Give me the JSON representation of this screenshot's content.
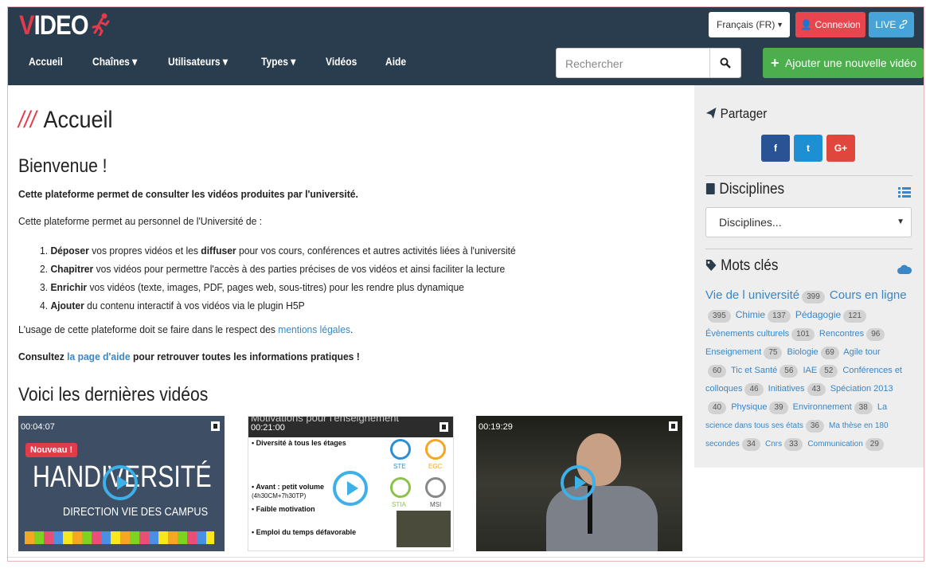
{
  "header": {
    "logo": {
      "prefix": "V",
      "rest": "IDEO"
    },
    "language": "Français (FR)",
    "login": "Connexion",
    "live": "LIVE",
    "nav": [
      {
        "label": "Accueil"
      },
      {
        "label": "Chaînes ▾"
      },
      {
        "label": "Utilisateurs ▾"
      },
      {
        "label": "Types ▾"
      },
      {
        "label": "Vidéos"
      },
      {
        "label": "Aide"
      }
    ],
    "search_placeholder": "Rechercher",
    "add_video": "Ajouter une nouvelle vidéo"
  },
  "main": {
    "title_prefix": "///",
    "title": "Accueil",
    "welcome": "Bienvenue !",
    "intro_bold": "Cette plateforme permet de consulter les vidéos produites par l'université.",
    "intro2": "Cette plateforme permet au personnel de l'Université de :",
    "list": [
      {
        "n": "1.",
        "b": "Déposer",
        "t": " vos propres vidéos et les ",
        "b2": "diffuser",
        "t2": " pour vos cours, conférences et autres activités liées à l'université"
      },
      {
        "n": "2.",
        "b": "Chapitrer",
        "t": " vos vidéos pour permettre l'accès à des parties précises de vos vidéos et ainsi faciliter la lecture",
        "b2": "",
        "t2": ""
      },
      {
        "n": "3.",
        "b": "Enrichir",
        "t": " vos vidéos (texte, images, PDF, pages web, sous-titres) pour les rendre plus dynamique",
        "b2": "",
        "t2": ""
      },
      {
        "n": "4.",
        "b": "Ajouter",
        "t": " du contenu interactif à vos vidéos via le plugin H5P",
        "b2": "",
        "t2": ""
      }
    ],
    "usage_text": "L'usage de cette plateforme doit se faire dans le respect des ",
    "usage_link": "mentions légales",
    "usage_end": ".",
    "help_text": "Consultez ",
    "help_link": "la page d'aide",
    "help_end": " pour retrouver toutes les informations pratiques !",
    "latest_title": "Voici les dernières vidéos",
    "videos": [
      {
        "duration": "00:04:07",
        "badge": "Nouveau !",
        "big": "HANDIVERSITÉ",
        "sub": "DIRECTION VIE DES CAMPUS"
      },
      {
        "duration": "00:21:00",
        "top": "Motivations pour l'enseignement",
        "b1": "• Diversité à tous les étages",
        "b2": "• Avant : petit volume",
        "b2s": "(4h30CM+7h30TP)",
        "b3": "• Faible motivation",
        "b4": "• Emploi du temps défavorable",
        "c1": "STE",
        "c2": "EGC",
        "c3": "STIA",
        "c4": "MSI"
      },
      {
        "duration": "00:19:29"
      }
    ]
  },
  "sidebar": {
    "share_title": "Partager",
    "share_buttons": [
      {
        "label": "f",
        "color": "#2a5396"
      },
      {
        "label": "t",
        "color": "#1d8fd3"
      },
      {
        "label": "G+",
        "color": "#e0473c"
      }
    ],
    "disciplines_title": "Disciplines",
    "disciplines_select": "Disciplines...",
    "keywords_title": "Mots clés"
  },
  "colors": {
    "header_bg": "#2a3d4f",
    "accent_red": "#e23b4c",
    "login_red": "#e8454f",
    "live_blue": "#46a4d8",
    "add_green": "#4cae4c",
    "link_blue": "#3a86c6",
    "sidebar_bg": "#eeeeee"
  }
}
